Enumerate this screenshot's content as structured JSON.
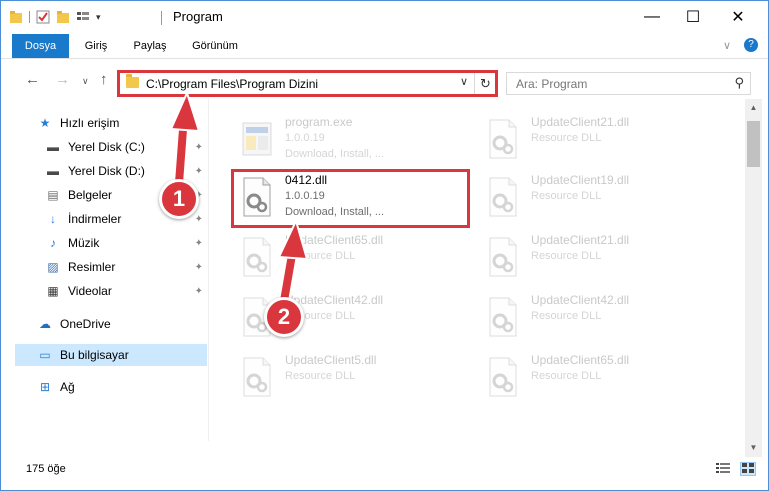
{
  "window": {
    "title": "Program",
    "controls": {
      "minimize": "—",
      "maximize": "☐",
      "close": "✕"
    }
  },
  "ribbon": {
    "tabs": [
      {
        "label": "Dosya",
        "active": true
      },
      {
        "label": "Giriş",
        "active": false
      },
      {
        "label": "Paylaş",
        "active": false
      },
      {
        "label": "Görünüm",
        "active": false
      }
    ],
    "expand_glyph": "∨",
    "help_glyph": "?"
  },
  "nav": {
    "back": "←",
    "forward": "→",
    "recent": "∨",
    "up": "↑",
    "address": "C:\\Program Files\\Program Dizini",
    "address_dropdown": "∨",
    "refresh": "↻",
    "search_placeholder": "Ara: Program",
    "search_icon": "⚲"
  },
  "sidebar": {
    "items": [
      {
        "label": "Hızlı erişim",
        "icon": "star-icon",
        "glyph": "★",
        "color": "#2b7cd3",
        "pinned": false
      },
      {
        "label": "Yerel Disk (C:)",
        "icon": "drive-icon",
        "glyph": "▬",
        "color": "#4a4a4a",
        "pinned": true
      },
      {
        "label": "Yerel Disk (D:)",
        "icon": "drive-icon",
        "glyph": "▬",
        "color": "#4a4a4a",
        "pinned": true
      },
      {
        "label": "Belgeler",
        "icon": "documents-icon",
        "glyph": "▤",
        "color": "#6d6d6d",
        "pinned": true
      },
      {
        "label": "İndirmeler",
        "icon": "download-icon",
        "glyph": "↓",
        "color": "#2b7cd3",
        "pinned": true
      },
      {
        "label": "Müzik",
        "icon": "music-icon",
        "glyph": "♪",
        "color": "#2b7cd3",
        "pinned": true
      },
      {
        "label": "Resimler",
        "icon": "pictures-icon",
        "glyph": "▨",
        "color": "#3c6ea8",
        "pinned": true
      },
      {
        "label": "Videolar",
        "icon": "videos-icon",
        "glyph": "▦",
        "color": "#3a3a3a",
        "pinned": true
      },
      {
        "label": "OneDrive",
        "icon": "cloud-icon",
        "glyph": "☁",
        "color": "#1f6fc4",
        "pinned": false
      },
      {
        "label": "Bu bilgisayar",
        "icon": "computer-icon",
        "glyph": "▭",
        "color": "#2b7cd3",
        "pinned": false,
        "selected": true
      },
      {
        "label": "Ağ",
        "icon": "network-icon",
        "glyph": "⊞",
        "color": "#2b7cd3",
        "pinned": false
      }
    ],
    "pin_glyph": "📌"
  },
  "files": [
    {
      "name": "program.exe",
      "line1": "1.0.0.19",
      "line2": "Download, Install, ...",
      "faded": true,
      "icon": "exe-icon"
    },
    {
      "name": "UpdateClient21.dll",
      "line1": "Resource DLL",
      "line2": "",
      "faded": true,
      "icon": "dll-icon"
    },
    {
      "name": "0412.dll",
      "line1": "1.0.0.19",
      "line2": "Download, Install, ...",
      "faded": false,
      "icon": "dll-icon"
    },
    {
      "name": "UpdateClient19.dll",
      "line1": "Resource DLL",
      "line2": "",
      "faded": true,
      "icon": "dll-icon"
    },
    {
      "name": "UpdateClient65.dll",
      "line1": "Resource DLL",
      "line2": "",
      "faded": true,
      "icon": "dll-icon"
    },
    {
      "name": "UpdateClient21.dll",
      "line1": "Resource DLL",
      "line2": "",
      "faded": true,
      "icon": "dll-icon"
    },
    {
      "name": "UpdateClient42.dll",
      "line1": "Resource DLL",
      "line2": "",
      "faded": true,
      "icon": "dll-icon"
    },
    {
      "name": "UpdateClient42.dll",
      "line1": "Resource DLL",
      "line2": "",
      "faded": true,
      "icon": "dll-icon"
    },
    {
      "name": "UpdateClient5.dll",
      "line1": "Resource DLL",
      "line2": "",
      "faded": true,
      "icon": "dll-icon"
    },
    {
      "name": "UpdateClient65.dll",
      "line1": "Resource DLL",
      "line2": "",
      "faded": true,
      "icon": "dll-icon"
    }
  ],
  "status": {
    "item_count": "175 öğe"
  },
  "annotations": {
    "badge1": "1",
    "badge2": "2",
    "color": "#d9363e"
  },
  "scrollbar": {
    "up": "▲",
    "down": "▼"
  }
}
